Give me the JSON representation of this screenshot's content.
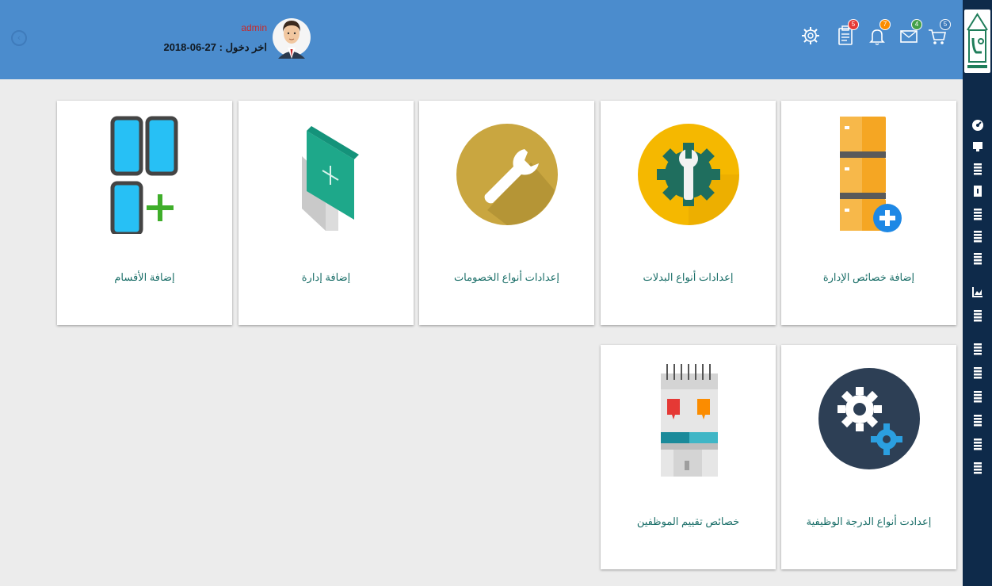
{
  "header": {
    "user_name": "admin",
    "last_login": "اخر دخول : 27-06-2018",
    "back_icon": "back-circle-icon",
    "icons": [
      {
        "name": "settings-gear-icon",
        "badge": ""
      },
      {
        "name": "clipboard-icon",
        "badge": "5",
        "badge_color": "#e53935"
      },
      {
        "name": "bell-icon",
        "badge": "7",
        "badge_color": "#fb8c00"
      },
      {
        "name": "mail-icon",
        "badge": "4",
        "badge_color": "#43a047"
      },
      {
        "name": "cart-icon",
        "badge": "5",
        "badge_color": "#3f7bbb"
      }
    ]
  },
  "sidebar": {
    "items": [
      "dashboard-gauge-icon",
      "monitor-icon",
      "list-icon",
      "phone-icon",
      "list-icon",
      "list-icon",
      "chart-icon",
      "list-icon",
      "list-icon",
      "list-icon",
      "list-icon",
      "list-icon",
      "list-icon"
    ]
  },
  "cards": [
    {
      "label": "إضافة خصائص الإدارة",
      "icon": "server-add-icon"
    },
    {
      "label": "إعدادات أنواع البدلات",
      "icon": "gear-wrench-icon"
    },
    {
      "label": "إعدادات أنواع الخصومات",
      "icon": "wrench-icon"
    },
    {
      "label": "إضافة إدارة",
      "icon": "add-tile-icon"
    },
    {
      "label": "إضافة الأقسام",
      "icon": "grid-add-icon"
    },
    {
      "label": "إعدادت أنواع الدرجة الوظيفية",
      "icon": "gears-icon"
    },
    {
      "label": "خصائص تقييم الموظفين",
      "icon": "notebook-icon"
    }
  ],
  "colors": {
    "header": "#4b8ccd",
    "sidebar": "#0e2a4a",
    "label": "#1a6e68",
    "background": "#ececec"
  }
}
